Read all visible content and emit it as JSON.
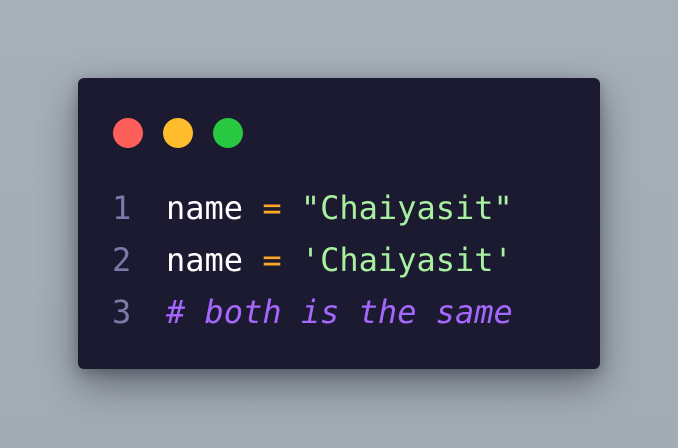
{
  "window": {
    "background": "#1b1a30",
    "controls": [
      {
        "name": "close",
        "color": "#ff5f5a"
      },
      {
        "name": "minimize",
        "color": "#ffbd2e"
      },
      {
        "name": "maximize",
        "color": "#28c840"
      }
    ]
  },
  "colors": {
    "line_number": "#7b7aa8",
    "identifier": "#ffffff",
    "operator": "#ffa726",
    "string": "#a8f0a0",
    "comment": "#a667ff"
  },
  "code": {
    "lines": [
      {
        "number": "1",
        "identifier": "name",
        "operator": "=",
        "value": "\"Chaiyasit\""
      },
      {
        "number": "2",
        "identifier": "name",
        "operator": "=",
        "value": "'Chaiyasit'"
      },
      {
        "number": "3",
        "comment": "# both is the same"
      }
    ]
  }
}
